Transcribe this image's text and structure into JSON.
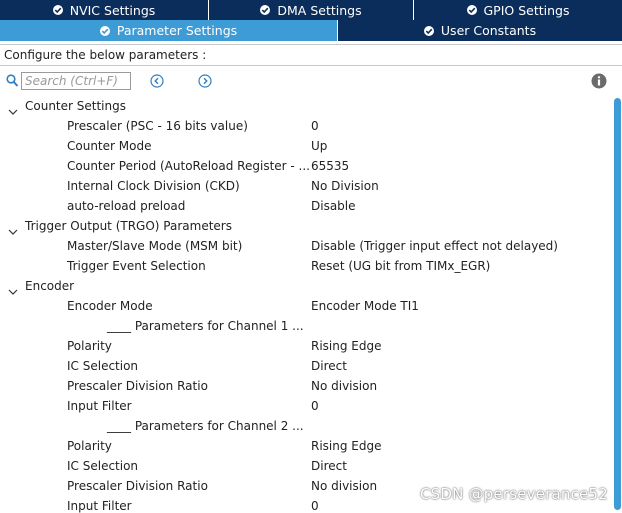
{
  "tabs_row1": [
    {
      "label": "NVIC Settings",
      "active": false
    },
    {
      "label": "DMA Settings",
      "active": false
    },
    {
      "label": "GPIO Settings",
      "active": false
    }
  ],
  "tabs_row2": [
    {
      "label": "Parameter Settings",
      "active": true
    },
    {
      "label": "User Constants",
      "active": false
    }
  ],
  "config_text": "Configure the below parameters :",
  "search": {
    "placeholder": "Search (Ctrl+F)"
  },
  "groups": [
    {
      "label": "Counter Settings",
      "params": [
        {
          "label": "Prescaler (PSC - 16 bits value)",
          "value": "0"
        },
        {
          "label": "Counter Mode",
          "value": "Up"
        },
        {
          "label": "Counter Period (AutoReload Register - ...",
          "value": "65535"
        },
        {
          "label": "Internal Clock Division (CKD)",
          "value": "No Division"
        },
        {
          "label": "auto-reload preload",
          "value": "Disable"
        }
      ]
    },
    {
      "label": "Trigger Output (TRGO) Parameters",
      "params": [
        {
          "label": "Master/Slave Mode (MSM bit)",
          "value": "Disable (Trigger input effect not delayed)"
        },
        {
          "label": "Trigger Event Selection",
          "value": "Reset (UG bit from TIMx_EGR)"
        }
      ]
    },
    {
      "label": "Encoder",
      "params": [
        {
          "label": "Encoder Mode",
          "value": "Encoder Mode TI1"
        },
        {
          "label": "____ Parameters for Channel 1 ...",
          "value": ""
        },
        {
          "label": "Polarity",
          "value": "Rising Edge"
        },
        {
          "label": "IC Selection",
          "value": "Direct"
        },
        {
          "label": "Prescaler Division Ratio",
          "value": "No division"
        },
        {
          "label": "Input Filter",
          "value": "0"
        },
        {
          "label": "____ Parameters for Channel 2 ...",
          "value": ""
        },
        {
          "label": "Polarity",
          "value": "Rising Edge"
        },
        {
          "label": "IC Selection",
          "value": "Direct"
        },
        {
          "label": "Prescaler Division Ratio",
          "value": "No division"
        },
        {
          "label": "Input Filter",
          "value": "0"
        }
      ]
    }
  ],
  "watermark": "CSDN @perseverance52",
  "colors": {
    "tab_dark": "#0b2d5b",
    "tab_active": "#3d9bd6",
    "accent": "#3d9bd6",
    "icon_gray": "#7a7a7a"
  },
  "icons": {
    "tab_check": "check-circle-icon",
    "search": "search-icon",
    "prev": "previous-icon",
    "next": "next-icon",
    "info": "info-icon",
    "expand": "chevron-down-icon"
  }
}
